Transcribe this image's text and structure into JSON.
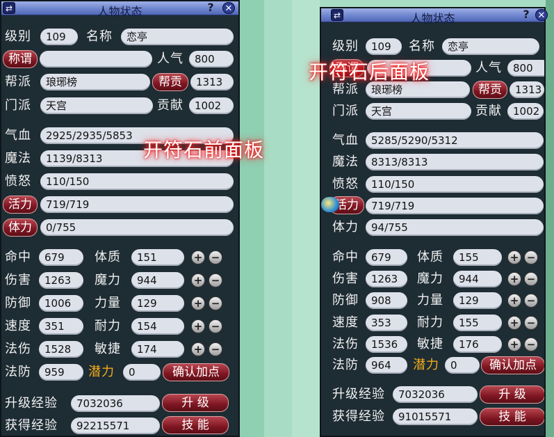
{
  "colors": {
    "accent_red": "#7d1621",
    "potential_gold": "#f5ad17",
    "panel_bg": "#1e2c34",
    "titlebar_blue": "#6f86cf"
  },
  "icons": {
    "swap": "swap-icon",
    "help": "help-icon",
    "close": "close-icon",
    "plus": "plus-icon",
    "minus": "minus-icon"
  },
  "overlays": {
    "before": "开符石前面板",
    "after": "开符石后面板"
  },
  "panels": [
    {
      "title": "人物状态",
      "help": "?",
      "labels": {
        "level": "级别",
        "name": "名称",
        "title": "称谓",
        "popularity": "人气",
        "guild": "帮派",
        "contrib_btn": "帮贡",
        "sect": "门派",
        "devotion": "贡献",
        "hp": "气血",
        "mp": "魔法",
        "rage": "愤怒",
        "vitality": "活力",
        "stamina": "体力",
        "hit": "命中",
        "damage": "伤害",
        "defense": "防御",
        "speed": "速度",
        "spell_dmg": "法伤",
        "spell_def": "法防",
        "constitution": "体质",
        "magic": "魔力",
        "strength": "力量",
        "endurance": "耐力",
        "agility": "敏捷",
        "potential": "潜力",
        "confirm": "确认加点",
        "exp_upgrade": "升级经验",
        "exp_gained": "获得经验",
        "upgrade_btn": "升 级",
        "skill_btn": "技 能"
      },
      "values": {
        "level": "109",
        "name": "恋亭",
        "title": "",
        "popularity": "800",
        "guild": "琅琊榜",
        "contrib": "1313",
        "sect": "天宫",
        "devotion": "1002",
        "hp": "2925/2935/5853",
        "mp": "1139/8313",
        "rage": "110/150",
        "vitality": "719/719",
        "stamina": "0/755",
        "hit": "679",
        "damage": "1263",
        "defense": "1006",
        "speed": "351",
        "spell_dmg": "1528",
        "spell_def": "959",
        "constitution": "151",
        "magic": "944",
        "strength": "129",
        "endurance": "154",
        "agility": "174",
        "potential": "0",
        "exp_upgrade": "7032036",
        "exp_gained": "92215571"
      }
    },
    {
      "title": "人物状态",
      "help": "?",
      "labels": {
        "level": "级别",
        "name": "名称",
        "title": "称谓",
        "popularity": "人气",
        "guild": "帮派",
        "contrib_btn": "帮贡",
        "sect": "门派",
        "devotion": "贡献",
        "hp": "气血",
        "mp": "魔法",
        "rage": "愤怒",
        "vitality": "活力",
        "stamina": "体力",
        "hit": "命中",
        "damage": "伤害",
        "defense": "防御",
        "speed": "速度",
        "spell_dmg": "法伤",
        "spell_def": "法防",
        "constitution": "体质",
        "magic": "魔力",
        "strength": "力量",
        "endurance": "耐力",
        "agility": "敏捷",
        "potential": "潜力",
        "confirm": "确认加点",
        "exp_upgrade": "升级经验",
        "exp_gained": "获得经验",
        "upgrade_btn": "升 级",
        "skill_btn": "技 能"
      },
      "values": {
        "level": "109",
        "name": "恋亭",
        "title": "",
        "popularity": "800",
        "guild": "琅琊榜",
        "contrib": "1313",
        "sect": "天宫",
        "devotion": "1002",
        "hp": "5285/5290/5312",
        "mp": "8313/8313",
        "rage": "110/150",
        "vitality": "719/719",
        "stamina": "94/755",
        "hit": "679",
        "damage": "1263",
        "defense": "908",
        "speed": "353",
        "spell_dmg": "1536",
        "spell_def": "964",
        "constitution": "155",
        "magic": "944",
        "strength": "129",
        "endurance": "155",
        "agility": "176",
        "potential": "0",
        "exp_upgrade": "7032036",
        "exp_gained": "91015571"
      }
    }
  ]
}
